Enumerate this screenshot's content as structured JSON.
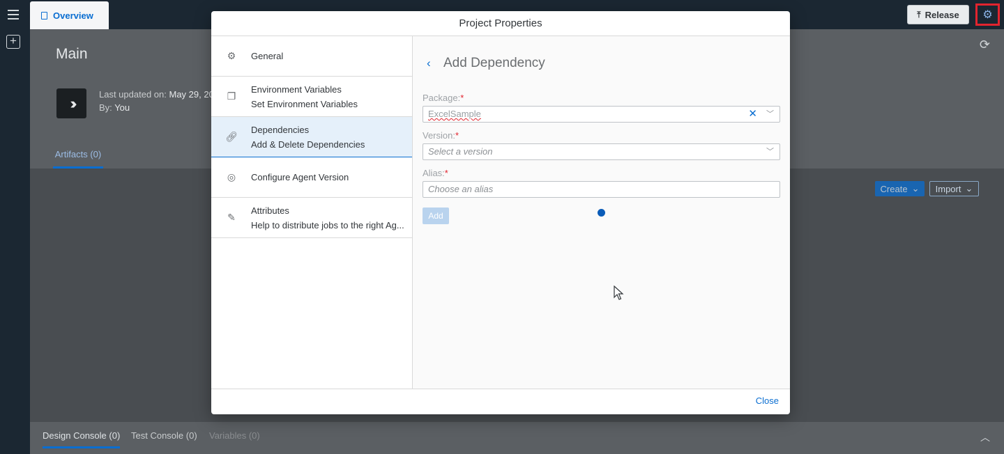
{
  "topbar": {
    "overview_tab": "Overview",
    "release_label": "Release"
  },
  "page": {
    "title": "Main",
    "last_updated_label": "Last updated on:",
    "last_updated_value": "May 29, 20",
    "by_label": "By:",
    "by_value": "You",
    "artifacts_tab": "Artifacts (0)",
    "create_label": "Create",
    "import_label": "Import"
  },
  "bottom_tabs": [
    {
      "label": "Design Console (0)"
    },
    {
      "label": "Test Console (0)"
    },
    {
      "label": "Variables (0)"
    }
  ],
  "dialog": {
    "title": "Project Properties",
    "nav": [
      {
        "label": "General",
        "sub": "",
        "icon": "gear-icon"
      },
      {
        "label": "Environment Variables",
        "sub": "Set Environment Variables",
        "icon": "document-icon"
      },
      {
        "label": "Dependencies",
        "sub": "Add & Delete Dependencies",
        "icon": "link-icon"
      },
      {
        "label": "Configure Agent Version",
        "sub": "",
        "icon": "robot-icon"
      },
      {
        "label": "Attributes",
        "sub": "Help to distribute jobs to the right Ag...",
        "icon": "attribute-icon"
      }
    ],
    "detail": {
      "title": "Add Dependency",
      "package_label": "Package:",
      "package_value": "ExcelSample",
      "version_label": "Version:",
      "version_placeholder": "Select a version",
      "alias_label": "Alias:",
      "alias_placeholder": "Choose an alias",
      "required_mark": "*",
      "add_label": "Add"
    },
    "close_label": "Close"
  },
  "colors": {
    "accent": "#0a6ed1",
    "shell": "#1b2732",
    "required": "#e1242e",
    "highlight_box": "#e1242e"
  }
}
